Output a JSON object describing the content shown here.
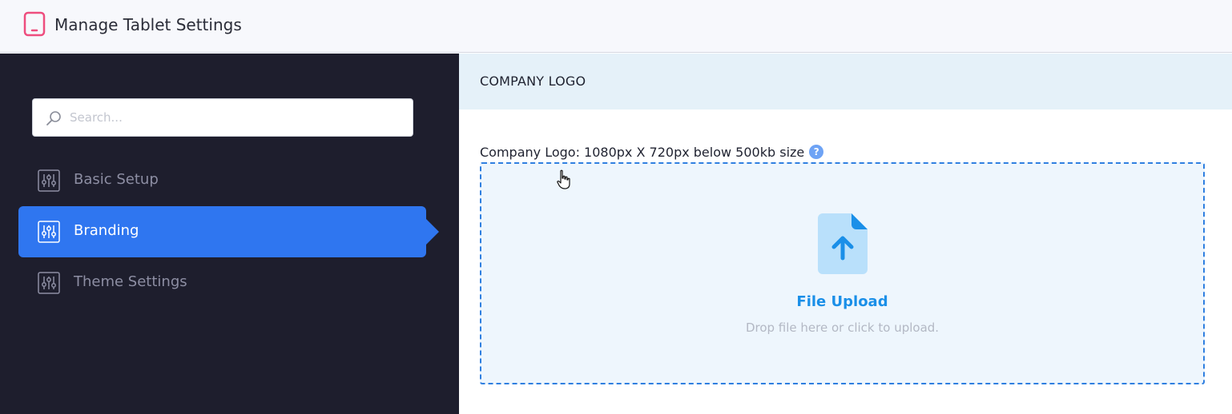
{
  "header": {
    "title": "Manage Tablet Settings",
    "icon": "tablet-icon",
    "icon_color": "#ee4d7e"
  },
  "sidebar": {
    "background": "#1e1e2d",
    "search": {
      "placeholder": "Search...",
      "value": ""
    },
    "items": [
      {
        "label": "Basic Setup",
        "icon": "sliders-icon",
        "active": false
      },
      {
        "label": "Branding",
        "icon": "sliders-icon",
        "active": true
      },
      {
        "label": "Theme Settings",
        "icon": "sliders-icon",
        "active": false
      }
    ],
    "active_color": "#2f76f0"
  },
  "main": {
    "section_title": "COMPANY LOGO",
    "field_label": "Company Logo: 1080px X 720px below 500kb size",
    "help_icon_text": "?",
    "upload": {
      "title": "File Upload",
      "hint": "Drop file here or click to upload.",
      "icon": "file-upload-icon",
      "accent": "#1a8fe8"
    }
  }
}
